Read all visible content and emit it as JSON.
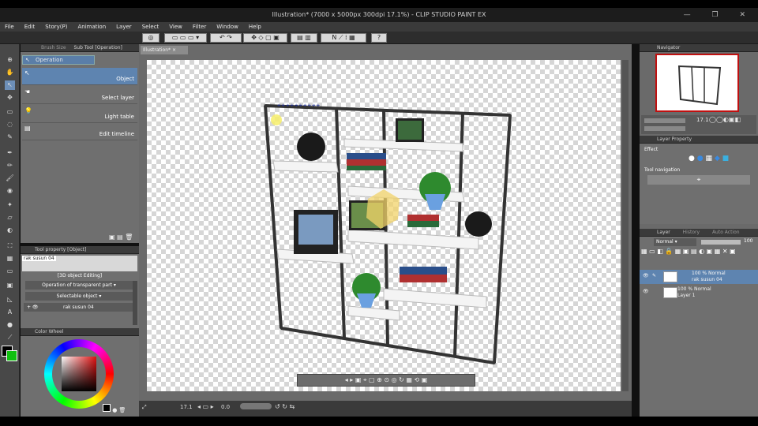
{
  "window": {
    "title": "Illustration* (7000 x 5000px 300dpi 17.1%) - CLIP STUDIO PAINT EX",
    "controls": [
      "—",
      "❐",
      "✕"
    ]
  },
  "menu": [
    "File",
    "Edit",
    "Story(P)",
    "Animation",
    "Layer",
    "Select",
    "View",
    "Filter",
    "Window",
    "Help"
  ],
  "subtool": {
    "tabs": [
      "Brush Size",
      "Sub Tool [Operation]"
    ],
    "group": "Operation",
    "items": [
      {
        "label": "Object",
        "icon": "pointer-icon"
      },
      {
        "label": "Select layer",
        "icon": "select-layer-icon"
      },
      {
        "label": "Light table",
        "icon": "light-table-icon"
      },
      {
        "label": "Edit timeline",
        "icon": "timeline-icon"
      }
    ]
  },
  "toolprop": {
    "header": "Tool property [Object]",
    "object_name": "rak susun 04",
    "mode": "[3D object Editing]",
    "transparent_label": "Operation of transparent part",
    "selectable_value": "Selectable object",
    "layer_value": "rak susun 04"
  },
  "color": {
    "header": "Color Wheel",
    "main_color": "#000000",
    "sub_color": "#10c010",
    "accent": "#24a0e0"
  },
  "document": {
    "tab": "Illustration*",
    "zoom": "17.1",
    "rotation": "0.0"
  },
  "navigator": {
    "header": "Navigator",
    "zoom": "17.1"
  },
  "layerprop": {
    "header": "Layer Property",
    "effect_label": "Effect",
    "tool_nav_label": "Tool navigation"
  },
  "layers": {
    "tabs": [
      "Layer",
      "History",
      "Auto Action"
    ],
    "blend_mode": "Normal",
    "opacity": "100",
    "rows": [
      {
        "title": "100 % Normal",
        "name": "rak susun 04"
      },
      {
        "title": "100 % Normal",
        "name": "Layer 1"
      }
    ]
  }
}
